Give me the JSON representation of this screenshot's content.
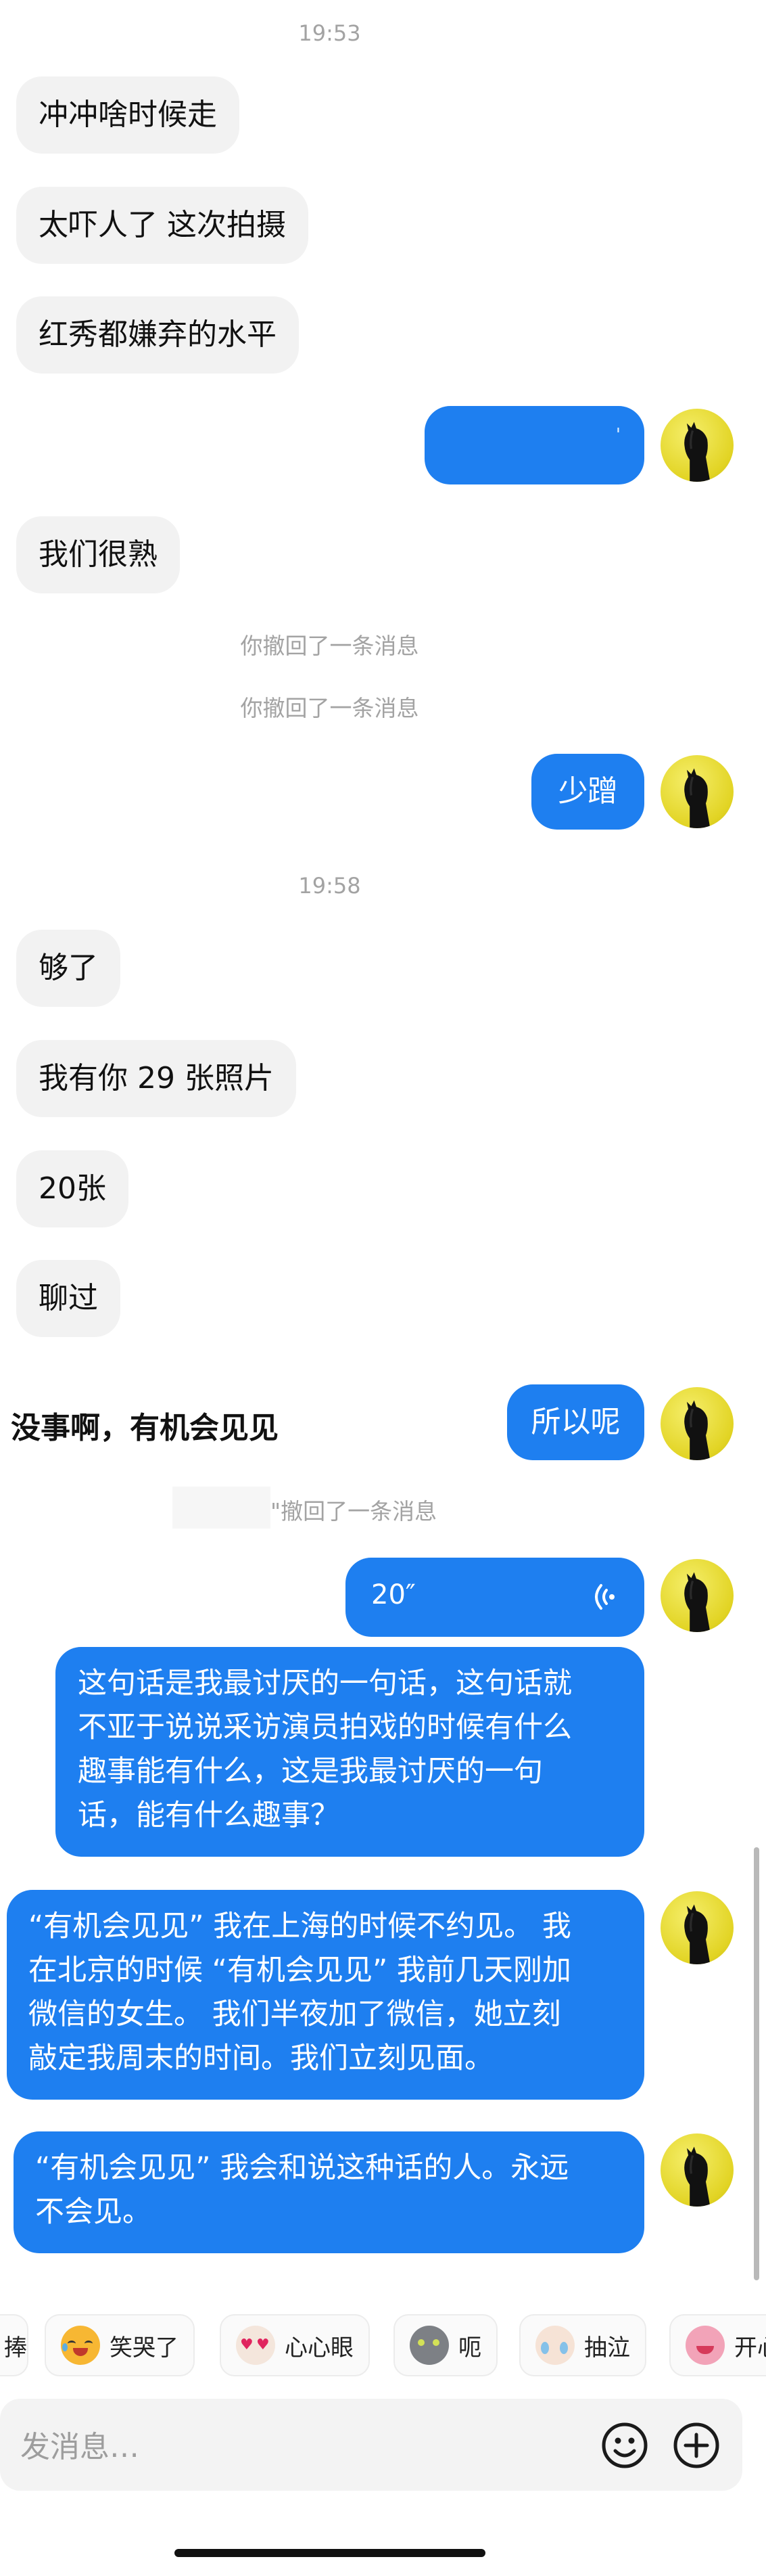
{
  "timestamps": [
    "19:53",
    "19:58"
  ],
  "messages": {
    "m1": "冲冲啥时候走",
    "m2": "太吓人了 这次拍摄",
    "m3": "红秀都嫌弃的水平",
    "m4_out_fragment": "'",
    "m5": "我们很熟",
    "recall_1": "你撤回了一条消息",
    "recall_2": "你撤回了一条消息",
    "m6_out": "少蹭",
    "m7": "够了",
    "m8": "我有你 29 张照片",
    "m9": "20张",
    "m10": "聊过",
    "bold_line": "没事啊，有机会见见",
    "m11_out": "所以呢",
    "recall_3": "\"撤回了一条消息",
    "voice_duration": "20″",
    "m12_out_lines": [
      "这句话是我最讨厌的一句话，这句话就",
      "不亚于说说采访演员拍戏的时候有什么",
      "趣事能有什么，这是我最讨厌的一句",
      "话，能有什么趣事？"
    ],
    "m13_out_lines": [
      "“有机会见见” 我在上海的时候不约见。 我",
      "在北京的时候 “有机会见见” 我前几天刚加",
      "微信的女生。 我们半夜加了微信，她立刻",
      "敲定我周末的时间。我们立刻见面。"
    ],
    "m14_out_lines": [
      "“有机会见见” 我会和说这种话的人。永远",
      "不会见。"
    ]
  },
  "emoji_bar": {
    "items": [
      {
        "label": "捧",
        "icon": "stick-icon"
      },
      {
        "label": "笑哭了",
        "icon": "laugh-cry-cat-icon"
      },
      {
        "label": "心心眼",
        "icon": "heart-eyes-cat-icon"
      },
      {
        "label": "呃",
        "icon": "grey-cat-icon"
      },
      {
        "label": "抽泣",
        "icon": "sobbing-cat-icon"
      },
      {
        "label": "开心",
        "icon": "happy-pink-icon"
      }
    ]
  },
  "input": {
    "placeholder": "发消息…"
  },
  "colors": {
    "outgoing_bubble": "#1e7ff0",
    "incoming_bubble": "#f2f2f2",
    "avatar_bg": "#e2d424"
  }
}
